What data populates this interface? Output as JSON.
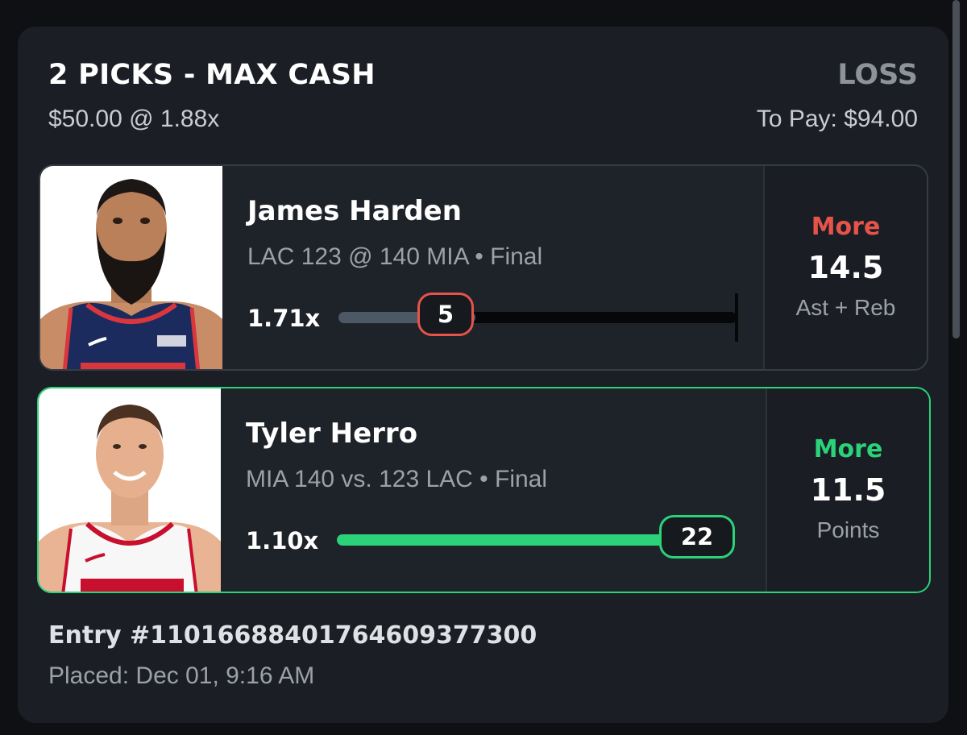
{
  "entry_header": {
    "title": "2 PICKS - MAX CASH",
    "status": "LOSS",
    "stake_text": "$50.00 @ 1.88x",
    "to_pay_text": "To Pay: $94.00"
  },
  "picks": [
    {
      "player": "James Harden",
      "photo_icon": "player-photo-icon",
      "game": "LAC 123 @ 140 MIA • Final",
      "multiplier": "1.71x",
      "actual": "5",
      "progress_fraction": 0.345,
      "result": "miss",
      "direction": "More",
      "direction_color": "#e5534b",
      "line": "14.5",
      "stat": "Ast + Reb"
    },
    {
      "player": "Tyler Herro",
      "photo_icon": "player-photo-icon",
      "game": "MIA 140 vs. 123 LAC • Final",
      "multiplier": "1.10x",
      "actual": "22",
      "progress_fraction": 1.0,
      "result": "hit",
      "direction": "More",
      "direction_color": "#2bd27a",
      "line": "11.5",
      "stat": "Points"
    }
  ],
  "footer": {
    "entry_id": "Entry #1101668840176460937730​0",
    "placed": "Placed: Dec 01, 9:16 AM"
  },
  "colors": {
    "accent_green": "#2bd27a",
    "accent_red": "#e5534b",
    "card_bg": "#1b1f25"
  }
}
